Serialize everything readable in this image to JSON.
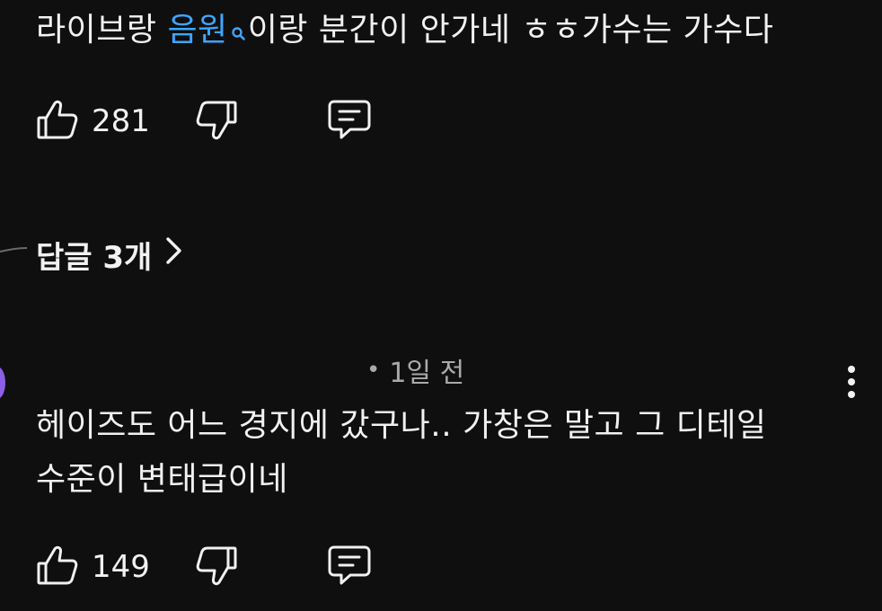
{
  "comment1": {
    "text_before": "라이브랑 ",
    "search_link": "음원",
    "text_after": "이랑 분간이 안가네 ㅎㅎ가수는 가수다",
    "likes": "281"
  },
  "replies": {
    "label": "답글 3개"
  },
  "comment2": {
    "author": "",
    "time": "1일 전",
    "separator": "•",
    "line1": "헤이즈도 어느 경지에 갔구나.. 가창은 말고 그 디테일",
    "line2": "수준이 변태급이네",
    "likes": "149"
  },
  "colors": {
    "background": "#0f0f0f",
    "text": "#f1f1f1",
    "link": "#3ea6ff",
    "meta": "#aaaaaa",
    "avatar": "#8e5ee6"
  },
  "icons": [
    "search-icon",
    "thumbs-up-icon",
    "thumbs-down-icon",
    "reply-icon",
    "chevron-right-icon",
    "more-vert-icon"
  ]
}
